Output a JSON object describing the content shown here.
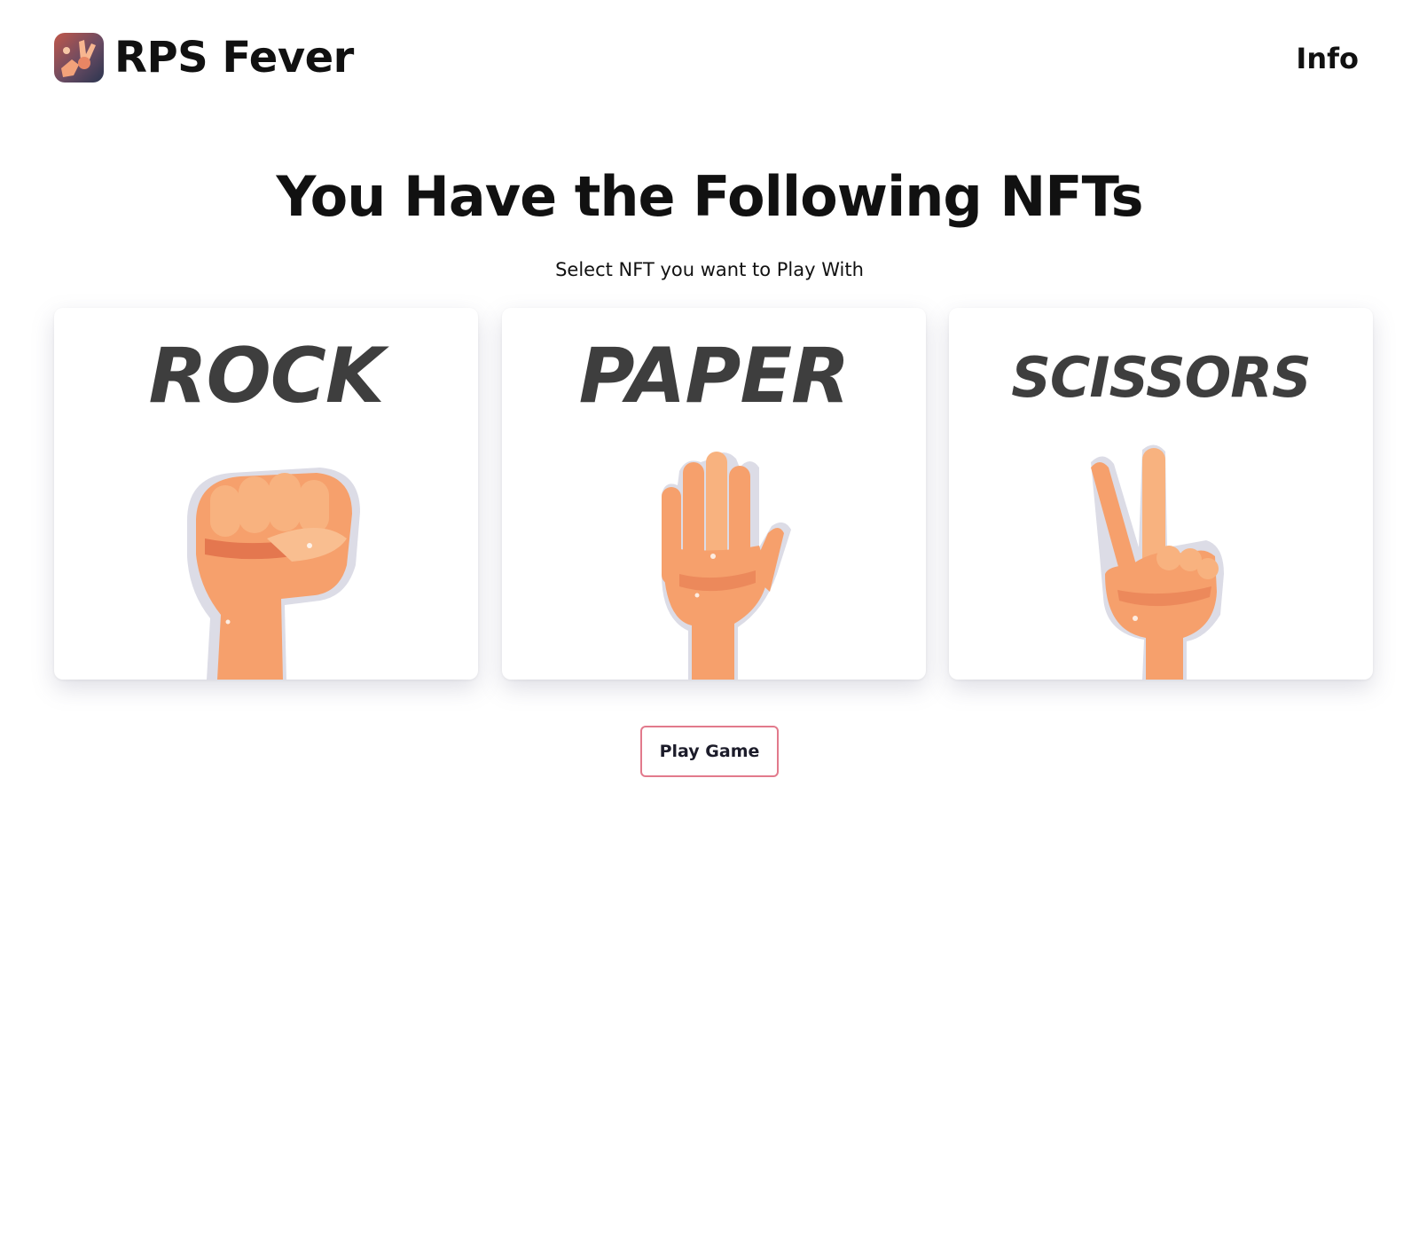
{
  "header": {
    "logo_icon": "rock-paper-scissors-hands-logo",
    "brand": "RPS Fever",
    "info_link": "Info"
  },
  "main": {
    "title": "You Have the Following NFTs",
    "subtitle": "Select NFT you want to Play With",
    "cards": [
      {
        "label": "ROCK",
        "icon": "fist-hand-icon"
      },
      {
        "label": "PAPER",
        "icon": "open-palm-hand-icon"
      },
      {
        "label": "SCISSORS",
        "icon": "victory-hand-icon"
      }
    ],
    "play_button": "Play Game"
  },
  "colors": {
    "skin": "#f6a06c",
    "skin_shadow": "#e4774f",
    "card_text": "#3e3e3e",
    "button_border": "#e27a8c"
  }
}
